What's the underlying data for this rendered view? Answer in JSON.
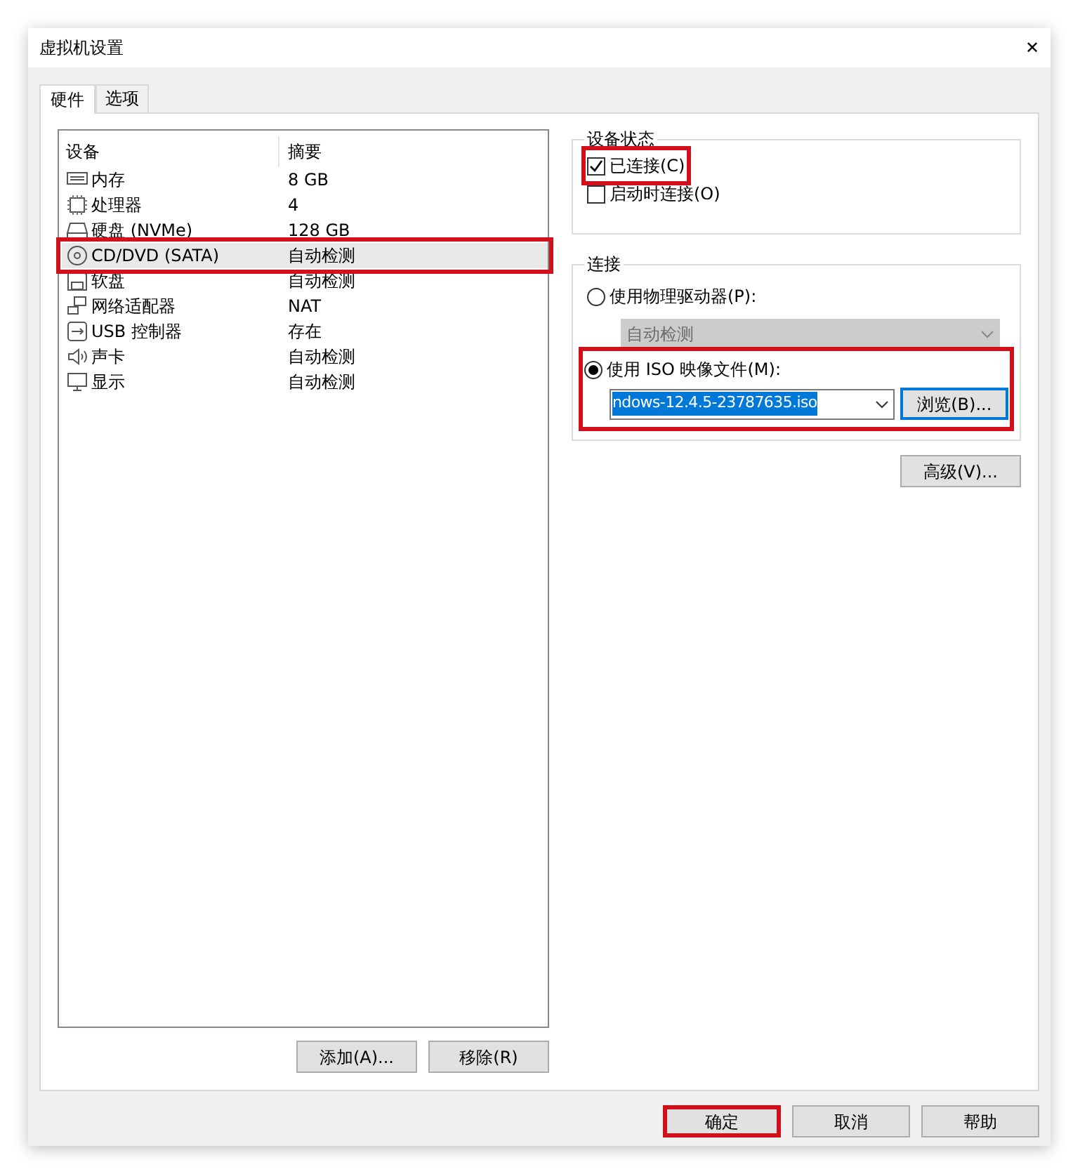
{
  "window": {
    "title": "虚拟机设置",
    "close": "✕"
  },
  "tabs": [
    {
      "label": "硬件",
      "selected": true
    },
    {
      "label": "选项",
      "selected": false
    }
  ],
  "devices": {
    "columns": [
      "设备",
      "摘要"
    ],
    "rows": [
      {
        "kind": "memory",
        "name": "内存",
        "summary": "8 GB",
        "selected": false,
        "highlighted": false
      },
      {
        "kind": "cpu",
        "name": "处理器",
        "summary": "4",
        "selected": false,
        "highlighted": false
      },
      {
        "kind": "disk",
        "name": "硬盘 (NVMe)",
        "summary": "128 GB",
        "selected": false,
        "highlighted": false
      },
      {
        "kind": "cd",
        "name": "CD/DVD (SATA)",
        "summary": "自动检测",
        "selected": true,
        "highlighted": true
      },
      {
        "kind": "floppy",
        "name": "软盘",
        "summary": "自动检测",
        "selected": false,
        "highlighted": false
      },
      {
        "kind": "network",
        "name": "网络适配器",
        "summary": "NAT",
        "selected": false,
        "highlighted": false
      },
      {
        "kind": "usb",
        "name": "USB 控制器",
        "summary": "存在",
        "selected": false,
        "highlighted": false
      },
      {
        "kind": "sound",
        "name": "声卡",
        "summary": "自动检测",
        "selected": false,
        "highlighted": false
      },
      {
        "kind": "display",
        "name": "显示",
        "summary": "自动检测",
        "selected": false,
        "highlighted": false
      }
    ],
    "buttons": [
      "添加(A)...",
      "移除(R)"
    ]
  },
  "device_status": {
    "title": "设备状态",
    "options": [
      {
        "label": "已连接(C)",
        "checked": true,
        "highlighted": true
      },
      {
        "label": "启动时连接(O)",
        "checked": false,
        "highlighted": false
      }
    ]
  },
  "connection": {
    "title": "连接",
    "physical": {
      "label": "使用物理驱动器(P):",
      "selected": false,
      "value": "自动检测",
      "disabled": true
    },
    "iso": {
      "label": "使用 ISO 映像文件(M):",
      "selected": true,
      "value": "ndows-12.4.5-23787635.iso",
      "browse": "浏览(B)...",
      "highlighted": true
    }
  },
  "advanced_button": "高级(V)...",
  "footer_buttons": [
    {
      "label": "确定",
      "highlighted": true
    },
    {
      "label": "取消",
      "highlighted": false
    },
    {
      "label": "帮助",
      "highlighted": false
    }
  ]
}
